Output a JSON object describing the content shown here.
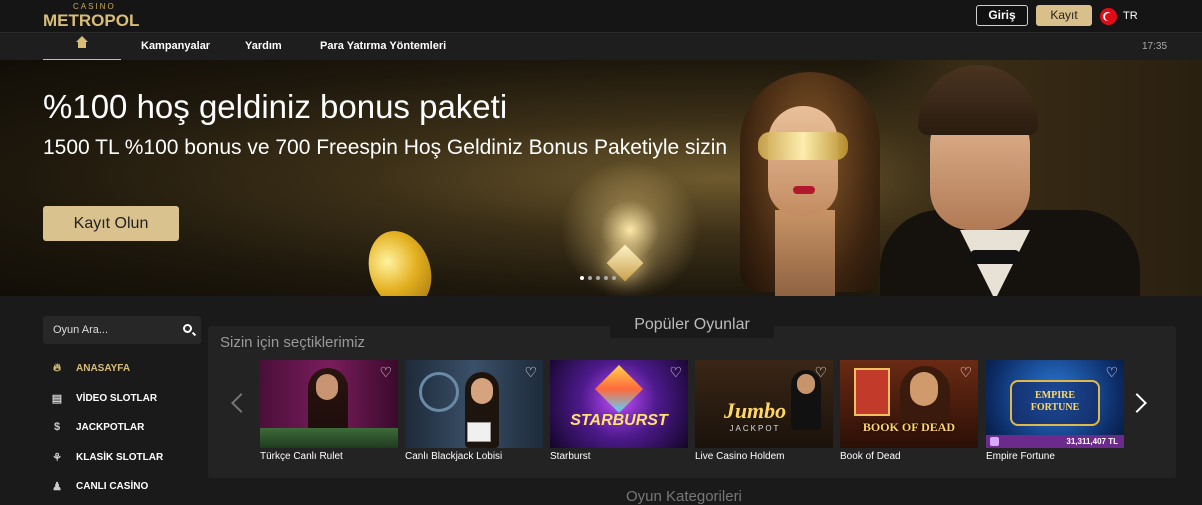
{
  "header": {
    "logo_small": "CASINO",
    "logo_big": "METROPOL",
    "login_label": "Giriş",
    "register_label": "Kayıt",
    "lang": "TR"
  },
  "nav": {
    "items": [
      "Kampanyalar",
      "Yardım",
      "Para Yatırma Yöntemleri"
    ],
    "clock": "17:35"
  },
  "hero": {
    "title": "%100 hoş geldiniz bonus paketi",
    "subtitle": "1500 TL %100 bonus ve 700 Freespin Hoş Geldiniz Bonus Paketiyle sizin",
    "cta": "Kayıt Olun",
    "slide_count": 5,
    "active_slide": 1
  },
  "sidebar": {
    "search_placeholder": "Oyun Ara...",
    "items": [
      {
        "label": "ANASAYFA",
        "icon": "flame-icon",
        "active": true
      },
      {
        "label": "VİDEO SLOTLAR",
        "icon": "slot-machine-icon"
      },
      {
        "label": "JACKPOTLAR",
        "icon": "money-bag-icon"
      },
      {
        "label": "KLASİK SLOTLAR",
        "icon": "cherries-icon"
      },
      {
        "label": "CANLI CASİNO",
        "icon": "dealer-icon"
      }
    ]
  },
  "popular": {
    "title": "Popüler Oyunlar",
    "subtitle": "Sizin için seçtiklerimiz",
    "games": [
      {
        "name": "Türkçe Canlı Rulet"
      },
      {
        "name": "Canlı Blackjack Lobisi"
      },
      {
        "name": "Starburst",
        "logo": "STARBURST"
      },
      {
        "name": "Live Casino Holdem",
        "logo": "Jumbo",
        "logo_sub": "JACKPOT"
      },
      {
        "name": "Book of Dead",
        "logo": "BOOK OF DEAD"
      },
      {
        "name": "Empire Fortune",
        "logo": "EMPIRE FORTUNE",
        "jackpot": "31,311,407 TL"
      }
    ]
  },
  "next_section_title": "Oyun Kategorileri",
  "colors": {
    "accent": "#d8bd78",
    "button_gold": "#dac28e",
    "jackpot_purple": "#6c2a8c"
  }
}
